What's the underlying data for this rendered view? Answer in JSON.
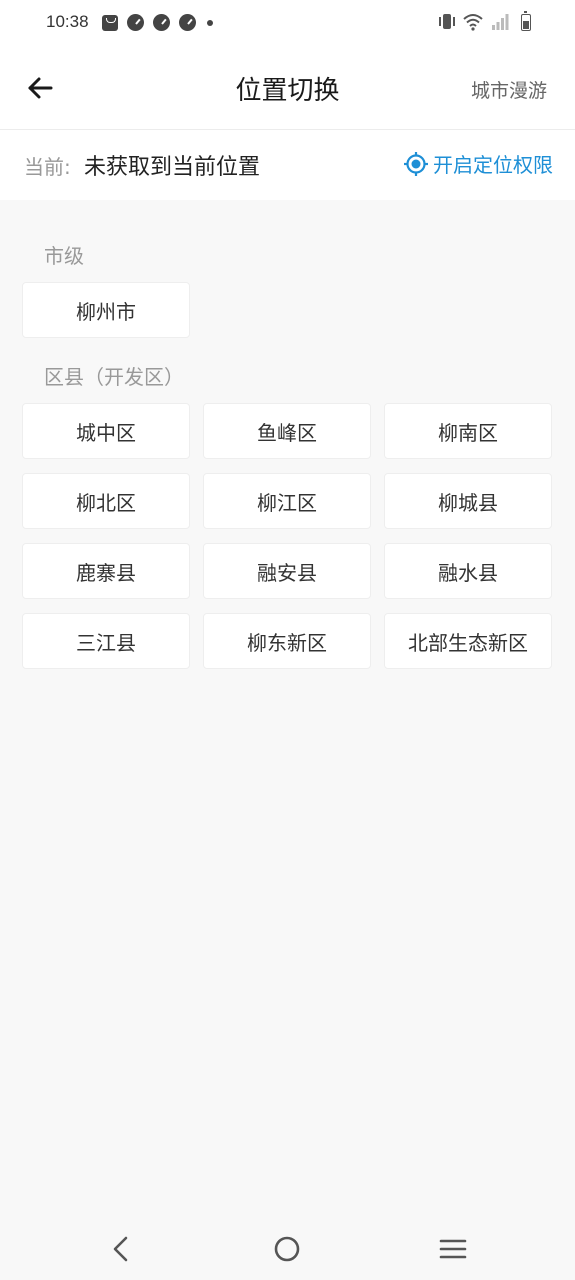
{
  "status_bar": {
    "time": "10:38",
    "left_icons": [
      "bag-icon",
      "gauge-icon",
      "gauge-icon",
      "gauge-icon",
      "dot-icon"
    ],
    "right_icons": [
      "vibrate-icon",
      "wifi-icon",
      "signal-icon",
      "battery-icon"
    ]
  },
  "header": {
    "back_icon": "arrow-left-icon",
    "title": "位置切换",
    "roam_label": "城市漫游"
  },
  "current_location": {
    "label": "当前:",
    "value": "未获取到当前位置",
    "enable_icon": "locate-icon",
    "enable_label": "开启定位权限",
    "accent_color": "#1e8fd6"
  },
  "sections": {
    "city": {
      "title": "市级",
      "items": [
        "柳州市"
      ]
    },
    "county": {
      "title": "区县（开发区）",
      "items": [
        "城中区",
        "鱼峰区",
        "柳南区",
        "柳北区",
        "柳江区",
        "柳城县",
        "鹿寨县",
        "融安县",
        "融水县",
        "三江县",
        "柳东新区",
        "北部生态新区"
      ]
    }
  },
  "nav_bar": {
    "icons": [
      "nav-back-icon",
      "nav-home-icon",
      "nav-menu-icon"
    ]
  }
}
